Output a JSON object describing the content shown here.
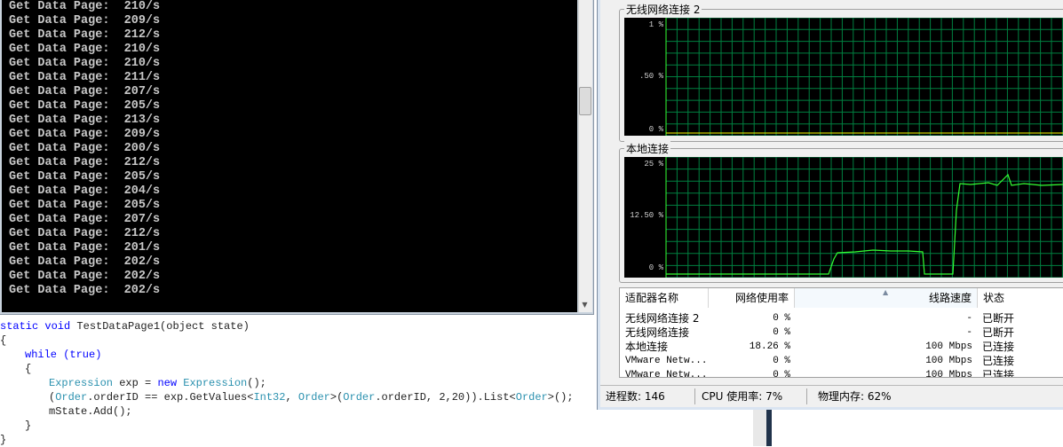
{
  "console": {
    "lines": [
      "Get Data Page:  210/s",
      "Get Data Page:  209/s",
      "Get Data Page:  212/s",
      "Get Data Page:  210/s",
      "Get Data Page:  210/s",
      "Get Data Page:  211/s",
      "Get Data Page:  207/s",
      "Get Data Page:  205/s",
      "Get Data Page:  213/s",
      "Get Data Page:  209/s",
      "Get Data Page:  200/s",
      "Get Data Page:  212/s",
      "Get Data Page:  205/s",
      "Get Data Page:  204/s",
      "Get Data Page:  205/s",
      "Get Data Page:  207/s",
      "Get Data Page:  212/s",
      "Get Data Page:  201/s",
      "Get Data Page:  202/s",
      "Get Data Page:  202/s",
      "Get Data Page:  202/s"
    ]
  },
  "code": {
    "l1_kw": "static void ",
    "l1_rest": "TestDataPage1(object state)",
    "l2": "{",
    "l3_kw": "while (true)",
    "l4": "{",
    "l5_type": "Expression",
    "l5_mid": " exp = ",
    "l5_new": "new ",
    "l5_type2": "Expression",
    "l5_end": "();",
    "l6_a": "(",
    "l6_order": "Order",
    "l6_b": ".orderID == exp.GetValues<",
    "l6_int": "Int32",
    "l6_c": ", ",
    "l6_order2": "Order",
    "l6_d": ">(",
    "l6_order3": "Order",
    "l6_e": ".orderID, 2,20)).List<",
    "l6_order4": "Order",
    "l6_f": ">();",
    "l7": "mState.Add();",
    "l8": "}",
    "l9": "}"
  },
  "taskmgr": {
    "wireless_panel": {
      "title": "无线网络连接 2",
      "y_labels": [
        "1 %",
        ".50 %",
        "0 %"
      ]
    },
    "local_panel": {
      "title": "本地连接",
      "y_labels": [
        "25 %",
        "12.50 %",
        "0 %"
      ]
    },
    "table": {
      "headers": [
        "适配器名称",
        "网络使用率",
        "线路速度",
        "状态"
      ],
      "rows": [
        [
          "无线网络连接 2",
          "0 %",
          "-",
          "已断开"
        ],
        [
          "无线网络连接",
          "0 %",
          "-",
          "已断开"
        ],
        [
          "本地连接",
          "18.26 %",
          "100 Mbps",
          "已连接"
        ],
        [
          "VMware Netw...",
          "0 %",
          "100 Mbps",
          "已连接"
        ],
        [
          "VMware Netw...",
          "0 %",
          "100 Mbps",
          "已连接"
        ]
      ]
    },
    "status": {
      "processes": "进程数: 146",
      "cpu": "CPU 使用率: 7%",
      "memory": "物理内存: 62%"
    }
  },
  "colors": {
    "graph_line": "#33ff33",
    "grid": "#008040",
    "keyword": "#0000ff",
    "type": "#2b91af"
  }
}
